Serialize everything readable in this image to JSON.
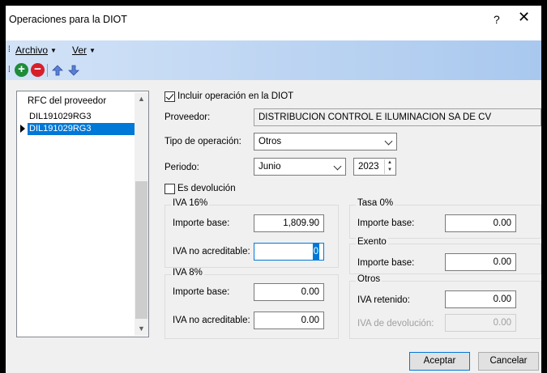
{
  "window": {
    "title": "Operaciones para la DIOT",
    "help": "?",
    "close": "✕"
  },
  "menu": {
    "archivo": "Archivo",
    "ver": "Ver"
  },
  "toolbar": {
    "add": "+",
    "remove": "−"
  },
  "list": {
    "header": "RFC del proveedor",
    "rows": [
      "DIL191029RG3",
      "DIL191029RG3"
    ]
  },
  "form": {
    "incluir_label": "Incluir operación en la DIOT",
    "incluir_checked": true,
    "proveedor_label": "Proveedor:",
    "proveedor_value": "DISTRIBUCION CONTROL E ILUMINACION SA DE CV",
    "tipo_label": "Tipo de operación:",
    "tipo_value": "Otros",
    "periodo_label": "Periodo:",
    "periodo_mes": "Junio",
    "periodo_anio": "2023",
    "devolucion_label": "Es devolución",
    "devolucion_checked": false
  },
  "iva16": {
    "title": "IVA 16%",
    "importe_label": "Importe base:",
    "importe_value": "1,809.90",
    "no_acred_label": "IVA no acreditable:",
    "no_acred_value": "0"
  },
  "iva8": {
    "title": "IVA 8%",
    "importe_label": "Importe base:",
    "importe_value": "0.00",
    "no_acred_label": "IVA no acreditable:",
    "no_acred_value": "0.00"
  },
  "tasa0": {
    "title": "Tasa 0%",
    "importe_label": "Importe base:",
    "importe_value": "0.00"
  },
  "exento": {
    "title": "Exento",
    "importe_label": "Importe base:",
    "importe_value": "0.00"
  },
  "otros": {
    "title": "Otros",
    "retenido_label": "IVA retenido:",
    "retenido_value": "0.00",
    "devolucion_label": "IVA de devolución:",
    "devolucion_value": "0.00"
  },
  "buttons": {
    "aceptar": "Aceptar",
    "cancelar": "Cancelar"
  },
  "colors": {
    "accent": "#0078d7",
    "toolbar_gradient_start": "#d3e3f7",
    "toolbar_gradient_end": "#a9c8ee"
  }
}
